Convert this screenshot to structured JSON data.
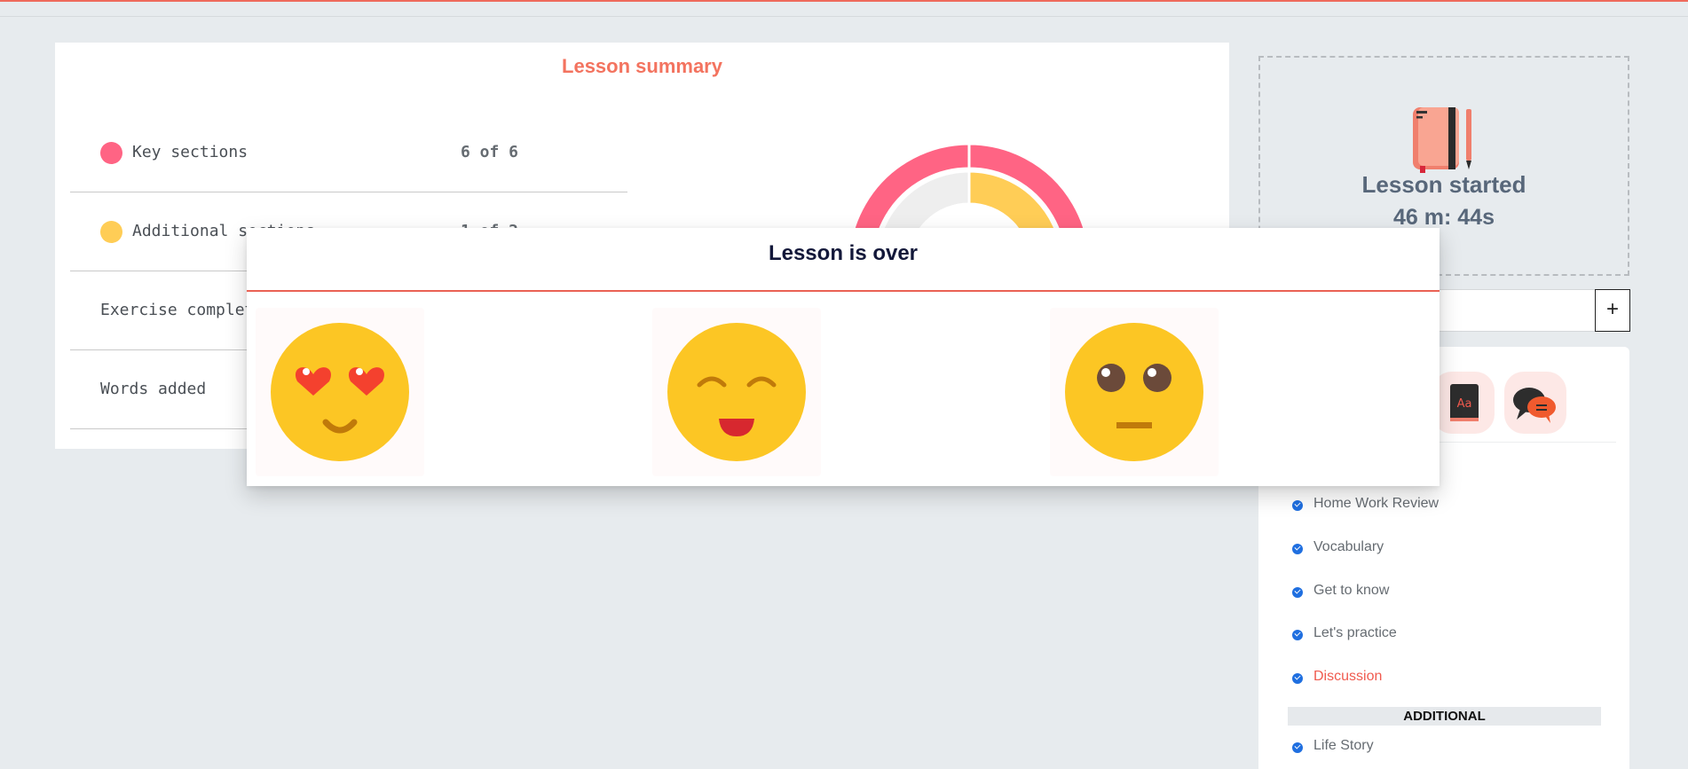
{
  "summary": {
    "title": "Lesson summary",
    "rows": [
      {
        "label": "Key sections",
        "value": "6 of 6",
        "color": "#ff6484"
      },
      {
        "label": "Additional sections",
        "value": "1 of 2",
        "color": "#ffcd56"
      },
      {
        "label": "Exercise completed",
        "value": ""
      },
      {
        "label": "Words added",
        "value": ""
      }
    ],
    "chart_data": {
      "type": "pie",
      "categories": [
        "Key sections",
        "Additional sections"
      ],
      "series": [
        {
          "name": "Key sections",
          "values": [
            6,
            0
          ],
          "color": "#ff6484"
        },
        {
          "name": "Additional sections",
          "values": [
            1,
            1
          ],
          "color": "#ffcd56"
        }
      ]
    }
  },
  "lesson": {
    "title": "Lesson started",
    "time": "46 m: 44s"
  },
  "toolbar": {
    "plus_label": "+",
    "tools": [
      "dictionary-icon",
      "chat-icon"
    ]
  },
  "sections": {
    "items": [
      {
        "label": "Home Work Review",
        "active": false
      },
      {
        "label": "Vocabulary",
        "active": false
      },
      {
        "label": "Get to know",
        "active": false
      },
      {
        "label": "Let's practice",
        "active": false
      },
      {
        "label": "Discussion",
        "active": true
      }
    ],
    "additional_heading": "ADDITIONAL",
    "additional_items": [
      {
        "label": "Life Story"
      }
    ]
  },
  "modal": {
    "title": "Lesson is over",
    "emojis": [
      "heart-eyes-emoji-icon",
      "smiling-emoji-icon",
      "neutral-emoji-icon"
    ]
  }
}
